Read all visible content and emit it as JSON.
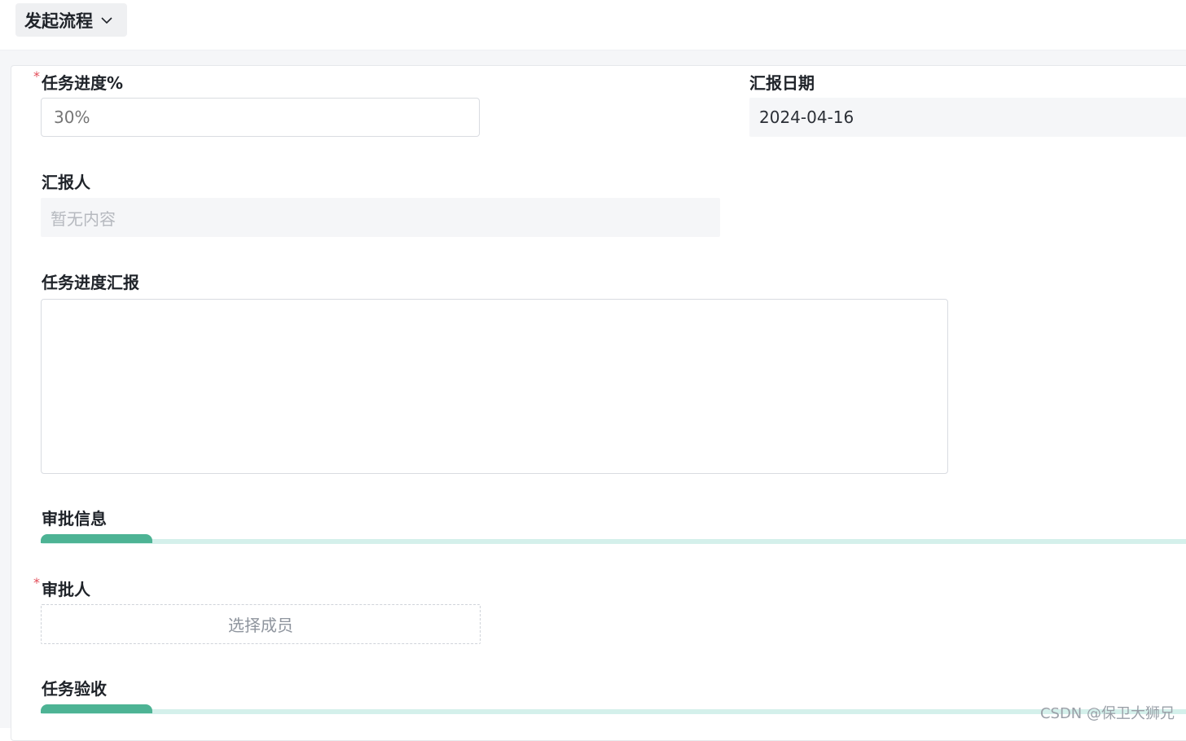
{
  "header": {
    "flow_button_label": "发起流程"
  },
  "form": {
    "task_progress": {
      "label": "任务进度%",
      "required_mark": "*",
      "placeholder": "30%"
    },
    "report_date": {
      "label": "汇报日期",
      "value": "2024-04-16"
    },
    "reporter": {
      "label": "汇报人",
      "value": "暂无内容"
    },
    "progress_report": {
      "label": "任务进度汇报",
      "value": ""
    }
  },
  "sections": {
    "approval": {
      "title": "审批信息",
      "approver": {
        "label": "审批人",
        "required_mark": "*",
        "picker_label": "选择成员"
      }
    },
    "acceptance": {
      "title": "任务验收"
    }
  },
  "watermark": "CSDN @保卫大狮兄",
  "colors": {
    "accent": "#4db394",
    "accent_light": "#d4f0eb",
    "required": "#e34d59",
    "readonly_bg": "#f5f6f8"
  }
}
